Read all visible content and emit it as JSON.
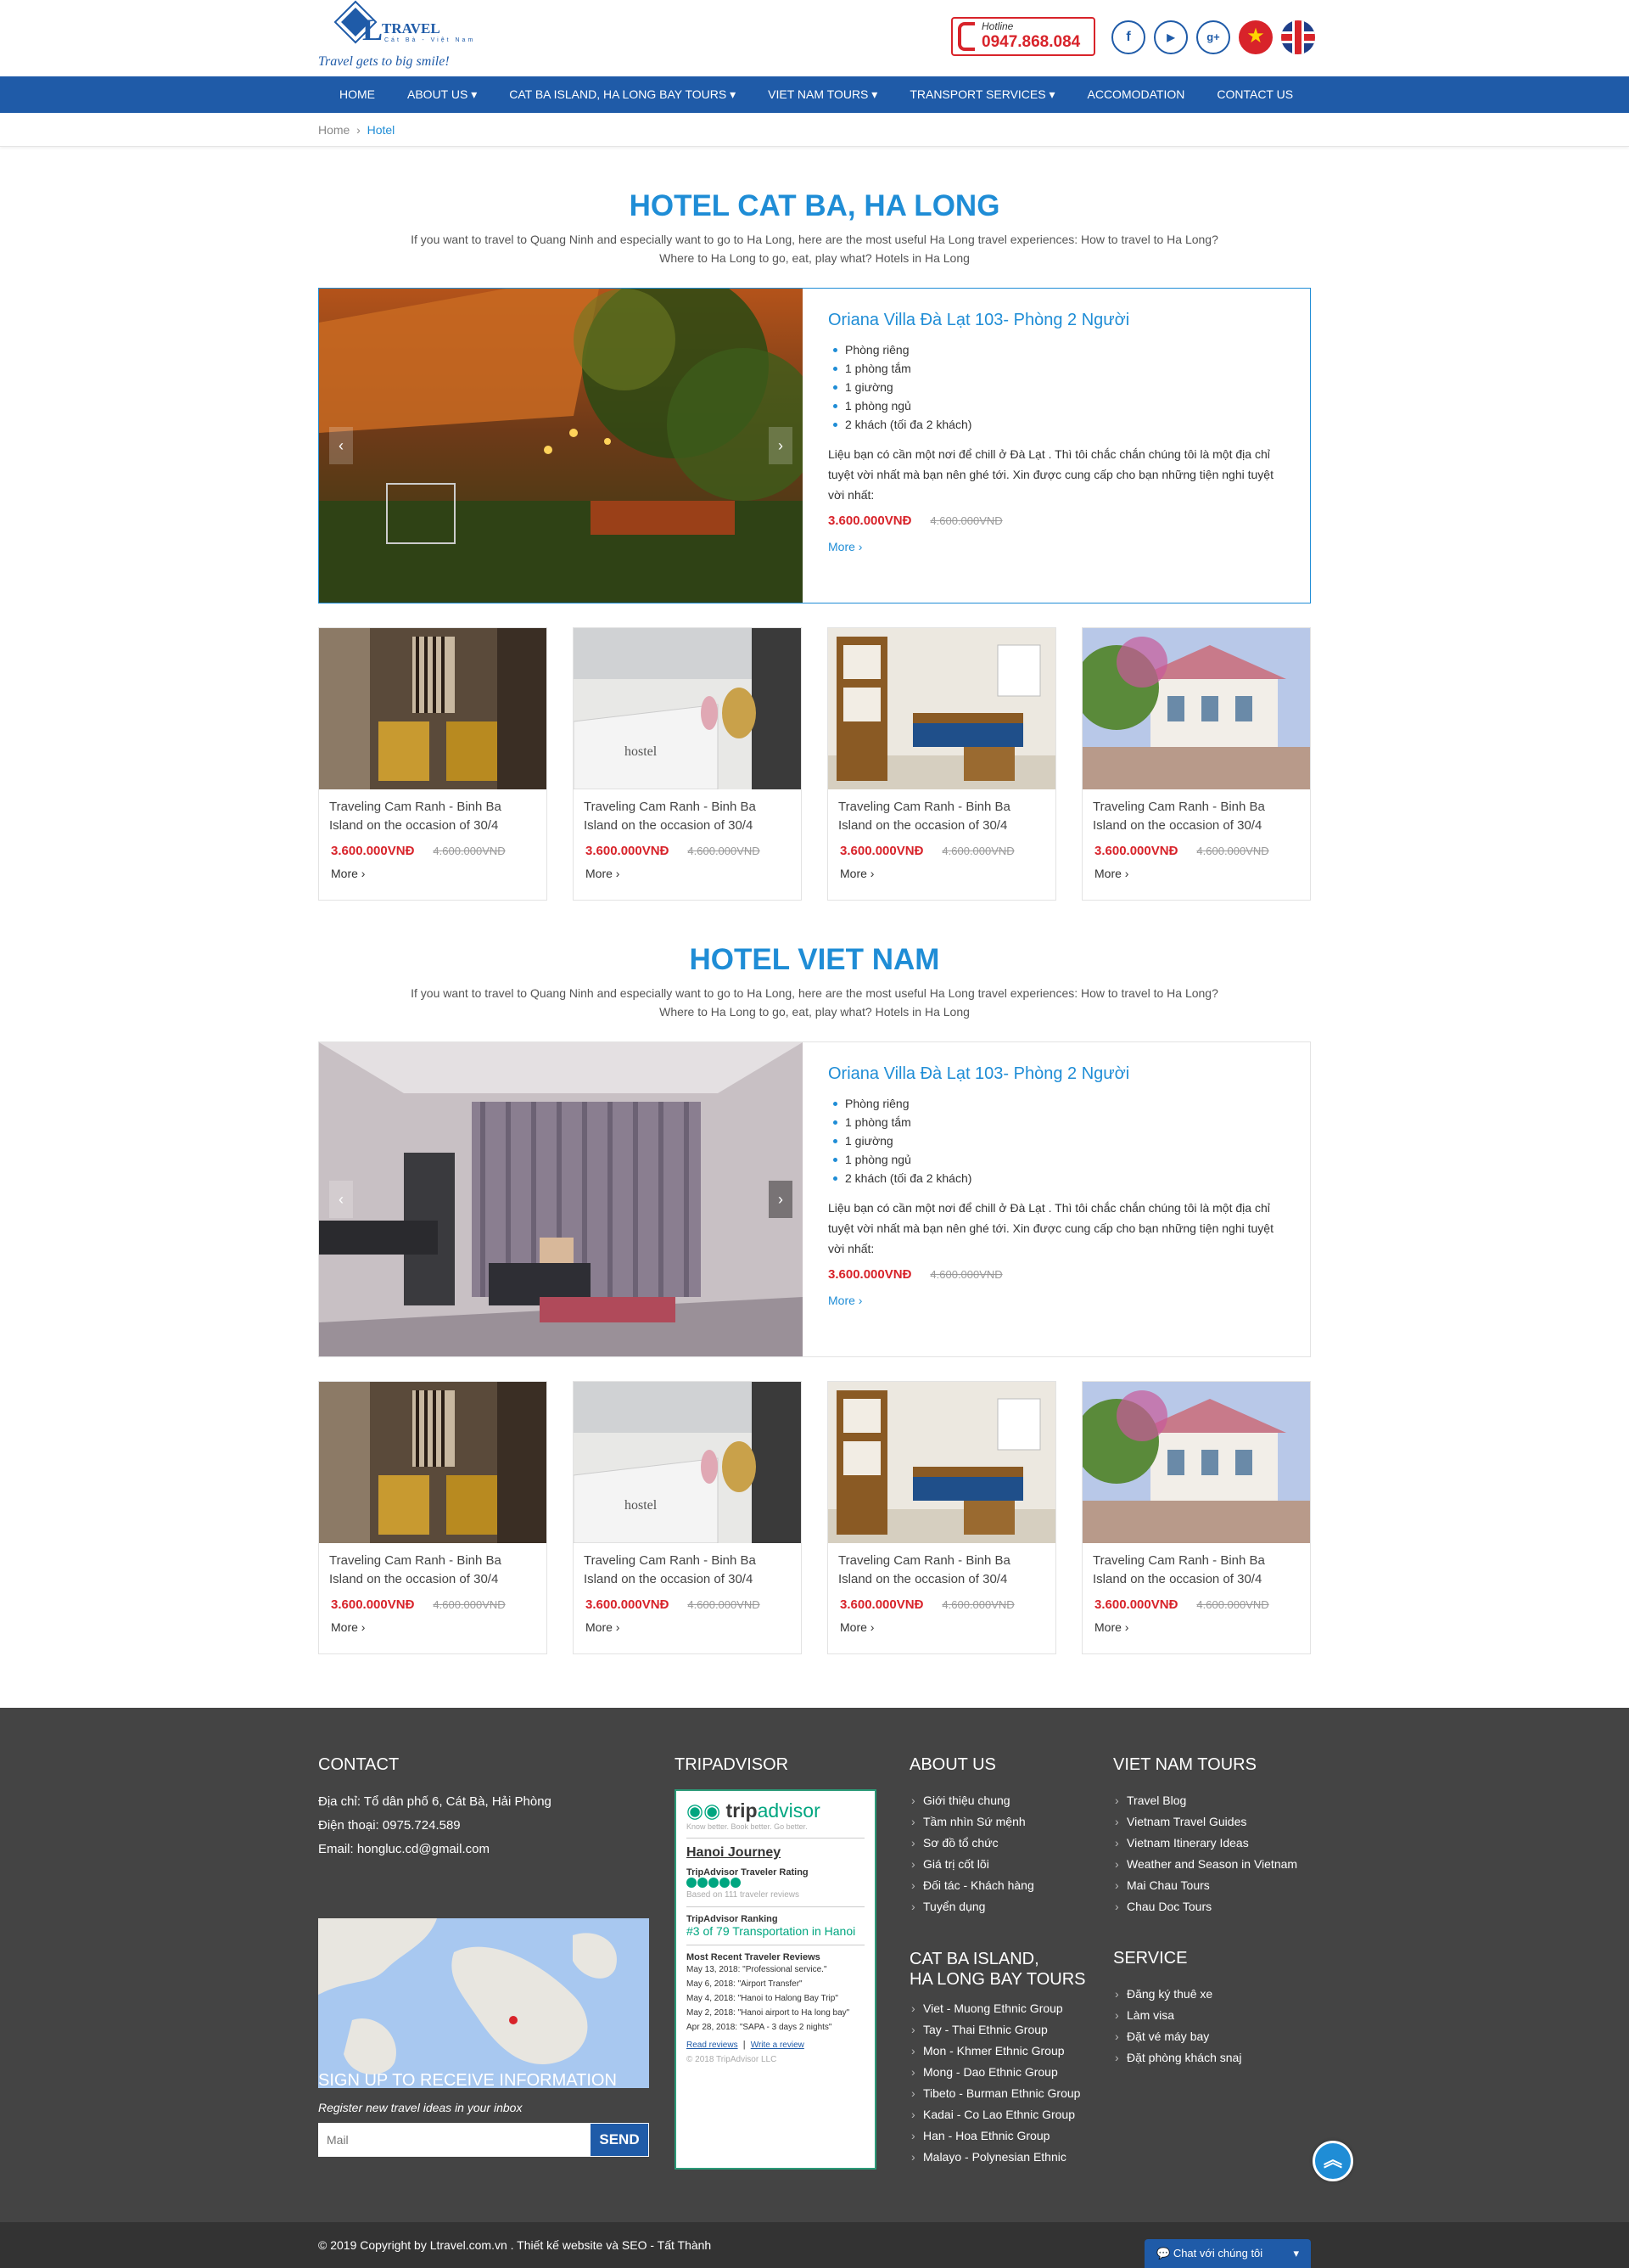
{
  "header": {
    "logo_text": "L",
    "logo_travel": "TRAVEL",
    "logo_sub": "Cát Bà - Việt Nam",
    "slogan": "Travel gets to big smile!",
    "hotline_label": "Hotline",
    "hotline_number": "0947.868.084",
    "social": [
      "f",
      "▶",
      "g+"
    ]
  },
  "nav": {
    "items": [
      "HOME",
      "ABOUT US ▾",
      "CAT BA ISLAND, HA LONG BAY TOURS ▾",
      "VIET NAM TOURS ▾",
      "TRANSPORT SERVICES ▾",
      "ACCOMODATION",
      "CONTACT US"
    ]
  },
  "breadcrumb": {
    "home": "Home",
    "sep": "›",
    "current": "Hotel"
  },
  "sections": [
    {
      "title": "HOTEL CAT BA, HA LONG",
      "desc": "If you want to travel to Quang Ninh and especially want to go to Ha Long, here are the most useful Ha Long travel experiences: How to travel to Ha Long? Where to Ha Long to go, eat, play what? Hotels in Ha Long",
      "feature": {
        "title": "Oriana Villa Đà Lạt 103- Phòng 2 Người",
        "amenities": [
          "Phòng riêng",
          "1 phòng tắm",
          "1 giường",
          "1 phòng ngủ",
          "2 khách (tối đa 2 khách)"
        ],
        "text": "Liệu bạn có cần một nơi để chill ở Đà Lạt . Thì tôi chắc chắn chúng tôi là một địa chỉ tuyệt vời nhất mà bạn nên ghé tới. Xin được cung cấp cho bạn những tiện nghi tuyệt vời nhất:",
        "price": "3.600.000VNĐ",
        "old_price": "4.600.000VNĐ",
        "more": "More ›"
      },
      "cards": [
        {
          "title": "Traveling Cam Ranh - Binh Ba Island on the occasion of 30/4",
          "price": "3.600.000VNĐ",
          "old_price": "4.600.000VNĐ",
          "more": "More ›"
        },
        {
          "title": "Traveling Cam Ranh - Binh Ba Island on the occasion of 30/4",
          "price": "3.600.000VNĐ",
          "old_price": "4.600.000VNĐ",
          "more": "More ›"
        },
        {
          "title": "Traveling Cam Ranh - Binh Ba Island on the occasion of 30/4",
          "price": "3.600.000VNĐ",
          "old_price": "4.600.000VNĐ",
          "more": "More ›"
        },
        {
          "title": "Traveling Cam Ranh - Binh Ba Island on the occasion of 30/4",
          "price": "3.600.000VNĐ",
          "old_price": "4.600.000VNĐ",
          "more": "More ›"
        }
      ]
    },
    {
      "title": "HOTEL VIET NAM",
      "desc": "If you want to travel to Quang Ninh and especially want to go to Ha Long, here are the most useful Ha Long travel experiences: How to travel to Ha Long? Where to Ha Long to go, eat, play what? Hotels in Ha Long",
      "feature": {
        "title": "Oriana Villa Đà Lạt 103- Phòng 2 Người",
        "amenities": [
          "Phòng riêng",
          "1 phòng tắm",
          "1 giường",
          "1 phòng ngủ",
          "2 khách (tối đa 2 khách)"
        ],
        "text": "Liệu bạn có cần một nơi để chill ở Đà Lạt . Thì tôi chắc chắn chúng tôi là một địa chỉ tuyệt vời nhất mà bạn nên ghé tới. Xin được cung cấp cho bạn những tiện nghi tuyệt vời nhất:",
        "price": "3.600.000VNĐ",
        "old_price": "4.600.000VNĐ",
        "more": "More ›"
      },
      "cards": [
        {
          "title": "Traveling Cam Ranh - Binh Ba Island on the occasion of 30/4",
          "price": "3.600.000VNĐ",
          "old_price": "4.600.000VNĐ",
          "more": "More ›"
        },
        {
          "title": "Traveling Cam Ranh - Binh Ba Island on the occasion of 30/4",
          "price": "3.600.000VNĐ",
          "old_price": "4.600.000VNĐ",
          "more": "More ›"
        },
        {
          "title": "Traveling Cam Ranh - Binh Ba Island on the occasion of 30/4",
          "price": "3.600.000VNĐ",
          "old_price": "4.600.000VNĐ",
          "more": "More ›"
        },
        {
          "title": "Traveling Cam Ranh - Binh Ba Island on the occasion of 30/4",
          "price": "3.600.000VNĐ",
          "old_price": "4.600.000VNĐ",
          "more": "More ›"
        }
      ]
    }
  ],
  "footer": {
    "contact": {
      "title": "CONTACT",
      "address": "Địa chỉ: Tổ dân phố 6, Cát Bà, Hải Phòng",
      "phone": "Điện thoại: 0975.724.589",
      "email": "Email: hongluc.cd@gmail.com"
    },
    "signup": {
      "title": "SIGN UP TO RECEIVE INFORMATION",
      "subtitle": "Register new travel ideas in your inbox",
      "placeholder": "Mail",
      "button": "SEND"
    },
    "tripadvisor": {
      "title": "TRIPADVISOR",
      "logo": "trip",
      "logo2": "advisor",
      "tagline": "Know better. Book better. Go better.",
      "name": "Hanoi Journey",
      "rating_label": "TripAdvisor Traveler Rating",
      "based": "Based on 111 traveler reviews",
      "ranking_label": "TripAdvisor Ranking",
      "ranking": "#3 of 79 Transportation in Hanoi",
      "recent_label": "Most Recent Traveler Reviews",
      "reviews": [
        "May 13, 2018: \"Professional service.\"",
        "May 6, 2018: \"Airport Transfer\"",
        "May 4, 2018: \"Hanoi to Halong Bay Trip\"",
        "May 2, 2018: \"Hanoi airport to Ha long bay\"",
        "Apr 28, 2018: \"SAPA - 3 days 2 nights\""
      ],
      "read": "Read reviews",
      "write": "Write a review",
      "copyright": "© 2018 TripAdvisor LLC"
    },
    "about": {
      "title": "ABOUT US",
      "items": [
        "Giới thiệu chung",
        "Tầm nhìn Sứ mệnh",
        "Sơ đồ tổ chức",
        "Giá trị cốt lõi",
        "Đối tác - Khách hàng",
        "Tuyển dụng"
      ]
    },
    "catba": {
      "title1": "CAT BA ISLAND,",
      "title2": "HA LONG BAY TOURS",
      "items": [
        "Viet - Muong Ethnic Group",
        "Tay - Thai Ethnic Group",
        "Mon - Khmer Ethnic Group",
        "Mong - Dao Ethnic Group",
        "Tibeto - Burman Ethnic Group",
        "Kadai - Co Lao Ethnic Group",
        "Han - Hoa Ethnic Group",
        "Malayo - Polynesian Ethnic"
      ]
    },
    "vntours": {
      "title": "VIET NAM TOURS",
      "items": [
        "Travel Blog",
        "Vietnam Travel Guides",
        "Vietnam Itinerary Ideas",
        "Weather and Season in Vietnam",
        "Mai Chau Tours",
        "Chau Doc Tours"
      ]
    },
    "service": {
      "title": "SERVICE",
      "items": [
        "Đăng ký thuê xe",
        "Làm visa",
        "Đặt vé máy bay",
        "Đặt phòng khách snaj"
      ]
    },
    "copyright": "© 2019 Copyright by Ltravel.com.vn . Thiết kế website và SEO - Tất Thành",
    "chat": "Chat với chúng tôi",
    "chat_caret": "▾"
  },
  "totop": "︽",
  "colors": {
    "brand": "#1f5ba8",
    "accent": "#1f8dd6",
    "price": "#d8232a",
    "footer": "#444444"
  }
}
